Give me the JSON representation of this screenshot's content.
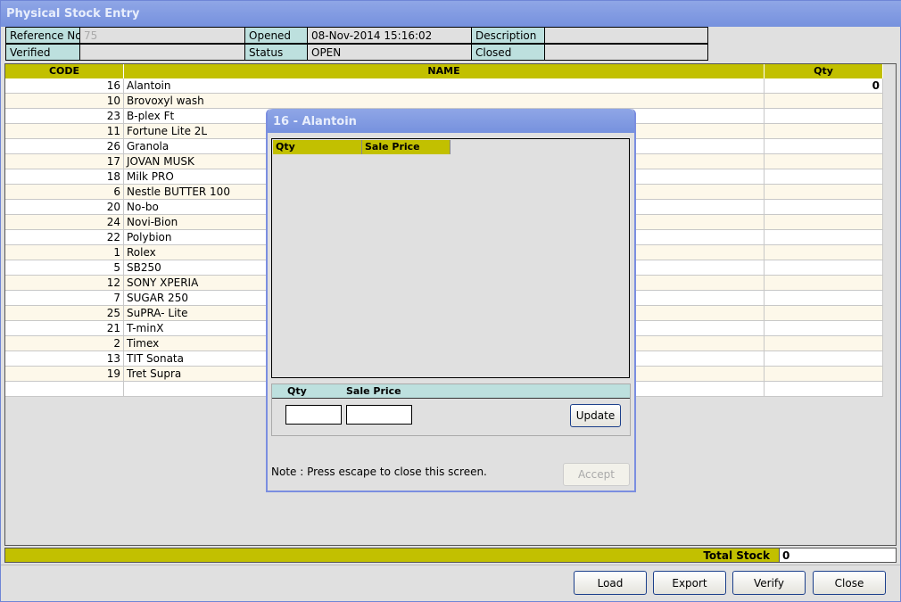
{
  "window": {
    "title": "Physical Stock Entry"
  },
  "info": {
    "reference_label": "Reference No",
    "reference_value": "75",
    "opened_label": "Opened",
    "opened_value": "08-Nov-2014 15:16:02",
    "description_label": "Description",
    "description_value": "",
    "verified_label": "Verified",
    "verified_value": "",
    "status_label": "Status",
    "status_value": "OPEN",
    "closed_label": "Closed",
    "closed_value": ""
  },
  "grid": {
    "headers": [
      "CODE",
      "NAME",
      "Qty"
    ],
    "rows": [
      {
        "code": "16",
        "name": "Alantoin",
        "qty": "0"
      },
      {
        "code": "10",
        "name": "Brovoxyl wash",
        "qty": ""
      },
      {
        "code": "23",
        "name": "B-plex Ft",
        "qty": ""
      },
      {
        "code": "11",
        "name": "Fortune Lite 2L",
        "qty": ""
      },
      {
        "code": "26",
        "name": "Granola",
        "qty": ""
      },
      {
        "code": "17",
        "name": "JOVAN MUSK",
        "qty": ""
      },
      {
        "code": "18",
        "name": "Milk PRO",
        "qty": ""
      },
      {
        "code": "6",
        "name": "Nestle BUTTER 100",
        "qty": ""
      },
      {
        "code": "20",
        "name": "No-bo",
        "qty": ""
      },
      {
        "code": "24",
        "name": "Novi-Bion",
        "qty": ""
      },
      {
        "code": "22",
        "name": "Polybion",
        "qty": ""
      },
      {
        "code": "1",
        "name": "Rolex",
        "qty": ""
      },
      {
        "code": "5",
        "name": "SB250",
        "qty": ""
      },
      {
        "code": "12",
        "name": "SONY XPERIA",
        "qty": ""
      },
      {
        "code": "7",
        "name": "SUGAR 250",
        "qty": ""
      },
      {
        "code": "25",
        "name": "SuPRA- Lite",
        "qty": ""
      },
      {
        "code": "21",
        "name": "T-minX",
        "qty": ""
      },
      {
        "code": "2",
        "name": "Timex",
        "qty": ""
      },
      {
        "code": "13",
        "name": "TIT Sonata",
        "qty": ""
      },
      {
        "code": "19",
        "name": "Tret Supra",
        "qty": ""
      },
      {
        "code": "",
        "name": "",
        "qty": ""
      }
    ]
  },
  "total": {
    "label": "Total Stock",
    "value": "0"
  },
  "buttons": {
    "load": "Load",
    "export": "Export",
    "verify": "Verify",
    "close": "Close"
  },
  "dialog": {
    "title": "16 - Alantoin",
    "list_headers": [
      "Qty",
      "Sale Price"
    ],
    "entry_headers": [
      "Qty",
      "Sale Price"
    ],
    "qty_value": "",
    "price_value": "",
    "update": "Update",
    "note": "Note : Press escape to close this screen.",
    "accept": "Accept"
  },
  "colors": {
    "header": "#c2c000",
    "label_bg": "#bde0de",
    "alt_row": "#fdf8ea",
    "title": "#7f98e0"
  }
}
